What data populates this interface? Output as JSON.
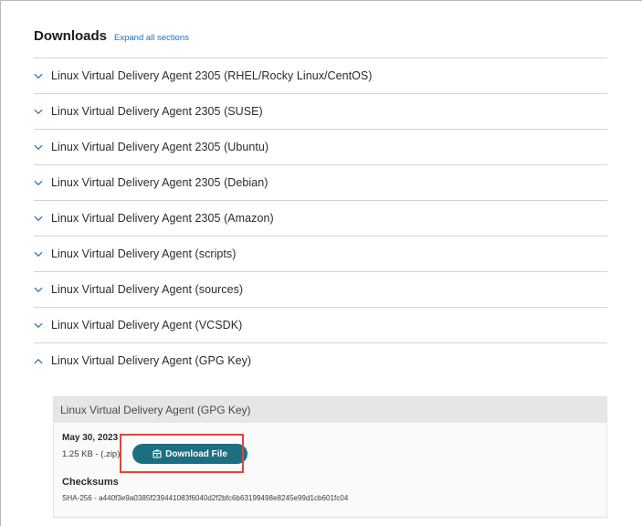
{
  "header": {
    "title": "Downloads",
    "expand_link": "Expand all sections"
  },
  "sections": [
    {
      "label": "Linux Virtual Delivery Agent 2305 (RHEL/Rocky Linux/CentOS)",
      "expanded": false
    },
    {
      "label": "Linux Virtual Delivery Agent 2305 (SUSE)",
      "expanded": false
    },
    {
      "label": "Linux Virtual Delivery Agent 2305 (Ubuntu)",
      "expanded": false
    },
    {
      "label": "Linux Virtual Delivery Agent 2305 (Debian)",
      "expanded": false
    },
    {
      "label": "Linux Virtual Delivery Agent 2305 (Amazon)",
      "expanded": false
    },
    {
      "label": "Linux Virtual Delivery Agent (scripts)",
      "expanded": false
    },
    {
      "label": "Linux Virtual Delivery Agent (sources)",
      "expanded": false
    },
    {
      "label": "Linux Virtual Delivery Agent (VCSDK)",
      "expanded": false
    },
    {
      "label": "Linux Virtual Delivery Agent (GPG Key)",
      "expanded": true
    }
  ],
  "panel": {
    "title": "Linux Virtual Delivery Agent (GPG Key)",
    "date": "May 30, 2023",
    "size": "1.25 KB - (.zip)",
    "download_label": "Download File",
    "checksums_title": "Checksums",
    "checksum_value": "SHA-256 - a440f3e9a0385f239441083f6040d2f2bfc6b63199498e8245e99d1cb601fc04"
  },
  "colors": {
    "accent_button": "#1b6f80",
    "link": "#1e6fb8",
    "highlight_box": "#e0453c"
  },
  "icons": {
    "collapsed": "chevron-down-icon",
    "expanded": "chevron-up-icon",
    "download": "download-box-icon"
  }
}
